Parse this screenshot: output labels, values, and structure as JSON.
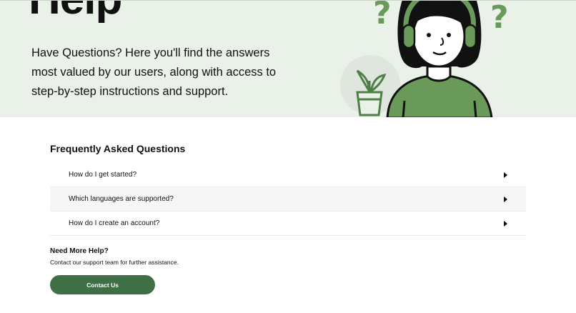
{
  "hero": {
    "title": "Help",
    "description": "Have Questions? Here you'll find the answers most valued by our users, along with access to step-by-step instructions and support."
  },
  "faq": {
    "heading": "Frequently Asked Questions",
    "items": [
      {
        "question": "How do I get started?",
        "icon": "caret-right-icon"
      },
      {
        "question": "Which languages are supported?",
        "icon": "caret-right-icon"
      },
      {
        "question": "How do I create an account?",
        "icon": "caret-right-icon"
      }
    ]
  },
  "help": {
    "heading": "Need More Help?",
    "description": "Contact our support team for further assistance.",
    "button_label": "Contact Us"
  },
  "colors": {
    "hero_bg": "#eaf1e9",
    "accent_green": "#3f6f45",
    "illustration_green": "#6a9a5a"
  }
}
